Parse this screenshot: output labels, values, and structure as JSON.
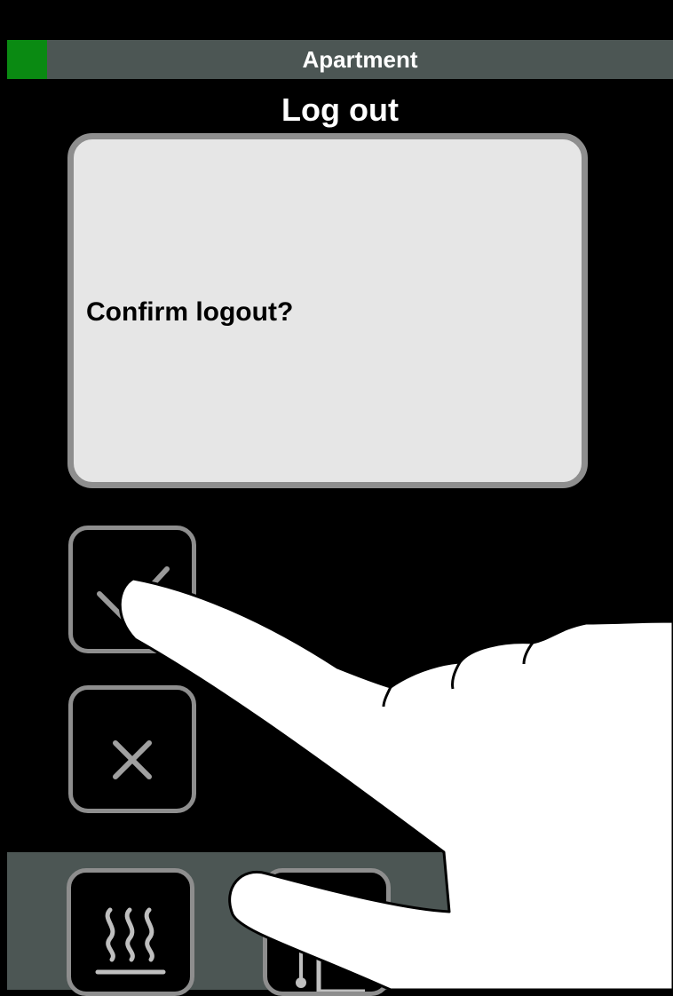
{
  "header": {
    "location_label": "Apartment",
    "status_color": "#0a8a12"
  },
  "page": {
    "title": "Log out"
  },
  "dialog": {
    "message": "Confirm logout?"
  },
  "buttons": {
    "top_icon": "check-icon",
    "cancel_icon": "close-icon",
    "confirm_icon": "check-icon"
  },
  "bottom_nav": {
    "items": [
      {
        "icon": "heating-icon"
      },
      {
        "icon": "thermometer-icon"
      }
    ]
  }
}
